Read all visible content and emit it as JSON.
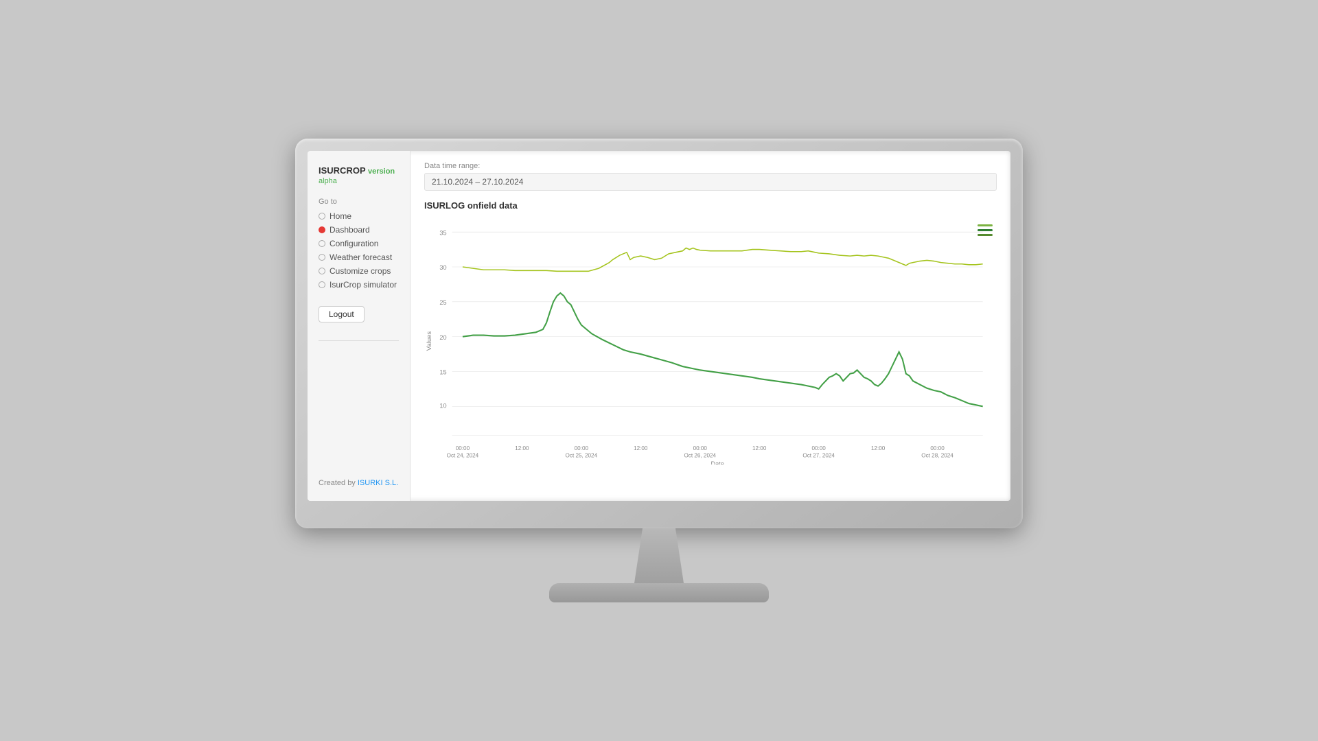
{
  "brand": {
    "name": "ISURCROP",
    "version": "version",
    "alpha": "alpha"
  },
  "sidebar": {
    "goto_label": "Go to",
    "nav_items": [
      {
        "id": "home",
        "label": "Home",
        "active": false
      },
      {
        "id": "dashboard",
        "label": "Dashboard",
        "active": true
      },
      {
        "id": "configuration",
        "label": "Configuration",
        "active": false
      },
      {
        "id": "weather-forecast",
        "label": "Weather forecast",
        "active": false
      },
      {
        "id": "customize-crops",
        "label": "Customize crops",
        "active": false
      },
      {
        "id": "isurcrop-simulator",
        "label": "IsurCrop simulator",
        "active": false
      }
    ],
    "logout_label": "Logout",
    "created_by_label": "Created by",
    "creator_name": "ISURKI S.L.",
    "creator_url": "#"
  },
  "main": {
    "date_range_label": "Data time range:",
    "date_range_value": "21.10.2024 – 27.10.2024",
    "chart_title": "ISURLOG onfield data",
    "chart": {
      "y_labels": [
        "35",
        "30",
        "25",
        "20",
        "15",
        "10"
      ],
      "x_labels": [
        {
          "time": "00:00",
          "date": "Oct 24, 2024"
        },
        {
          "time": "12:00",
          "date": ""
        },
        {
          "time": "00:00",
          "date": "Oct 25, 2024"
        },
        {
          "time": "12:00",
          "date": ""
        },
        {
          "time": "00:00",
          "date": "Oct 26, 2024"
        },
        {
          "time": "12:00",
          "date": ""
        },
        {
          "time": "00:00",
          "date": "Oct 27, 2024"
        },
        {
          "time": "12:00",
          "date": ""
        },
        {
          "time": "00:00",
          "date": "Oct 28, 2024"
        }
      ],
      "axis_label": "Values",
      "axis_bottom_label": "Date",
      "legend": [
        {
          "color": "#7cb342"
        },
        {
          "color": "#2e7d32"
        },
        {
          "color": "#558b2f"
        }
      ]
    }
  }
}
